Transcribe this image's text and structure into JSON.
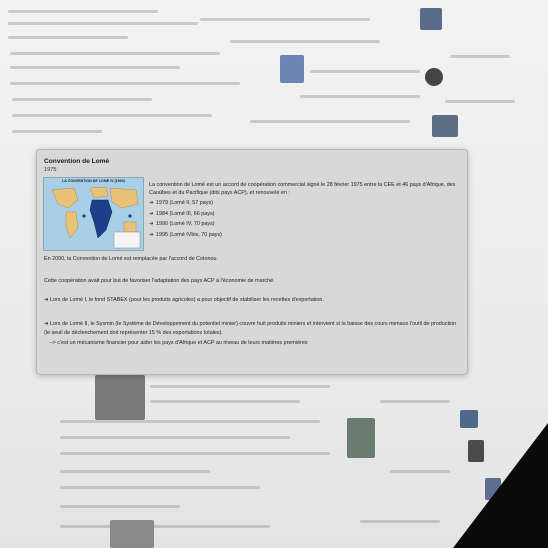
{
  "popup": {
    "title": "Convention de Lomé",
    "year": "1975",
    "map_title": "LA CONVENTION DE LOMÉ IV (1990)",
    "intro": "La convention de Lomé est un accord de coopération commercial signé le 28 février 1975 entre la CEE et 46 pays d'Afrique, des Caraïbes et du Pacifique (dits pays ACP), et renouvelé en :",
    "renewals": [
      "1979 (Lomé II, 57 pays)",
      "1984 (Lomé III, 66 pays)",
      "1990 (Lomé IV, 70 pays)",
      "1995 (Lomé IVbis, 70 pays)"
    ],
    "arrow": "➜",
    "paragraphs": [
      "En 2000, la Convention de Lomé est remplacée par l'accord de Cotonou.",
      "Cette coopération avait pour but de favoriser l'adaptation des pays ACP à l'économie de marché.",
      "➜ Lors de Lomé I, le fond STABEX (pour les produits agricoles) a pour objectif de stabiliser les recettes d'exportation.",
      "➜ Lors de Lomé II, le Sysmin (le Système de Développement du potentiel minier) couvre huit produits miniers et intervient si la baisse des cours menace l'outil de production (le seuil de déclenchement doit représenter 15 % des exportations totales).",
      "--> c'est un mécanisme financier pour aider les pays d'Afrique et ACP au niveau de leurs matières premières"
    ]
  }
}
